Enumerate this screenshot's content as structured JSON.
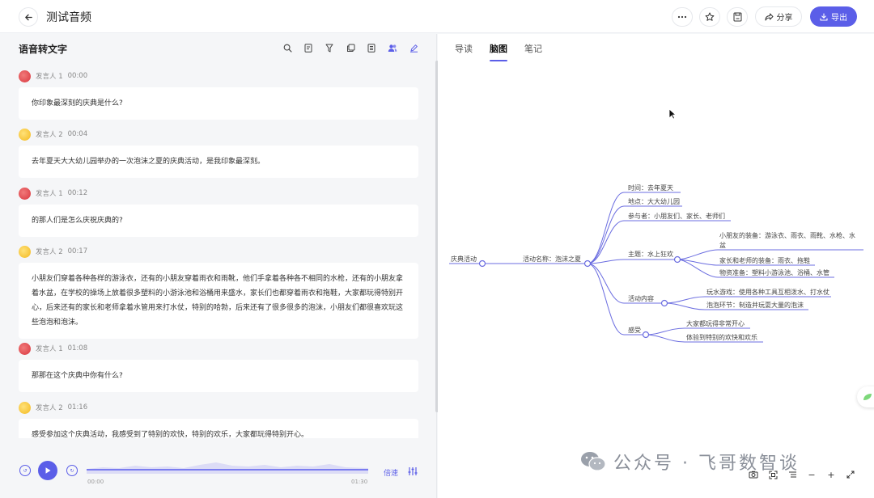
{
  "header": {
    "title": "测试音频",
    "share_label": "分享",
    "export_label": "导出"
  },
  "left_panel": {
    "title": "语音转文字",
    "entries": [
      {
        "speaker": "发言人 1",
        "time": "00:00",
        "avatar": "red",
        "text": "你印象最深刻的庆典是什么?"
      },
      {
        "speaker": "发言人 2",
        "time": "00:04",
        "avatar": "yellow",
        "text": "去年夏天大大幼儿园举办的一次泡沫之夏的庆典活动，是我印象最深刻。"
      },
      {
        "speaker": "发言人 1",
        "time": "00:12",
        "avatar": "red",
        "text": "的那人们是怎么庆祝庆典的?"
      },
      {
        "speaker": "发言人 2",
        "time": "00:17",
        "avatar": "yellow",
        "text": "小朋友们穿着各种各样的游泳衣，还有的小朋友穿着雨衣和雨靴，他们手拿着各种各不相同的水枪，还有的小朋友拿着水盆，在学校的操场上放着很多塑料的小游泳池和浴桶用来盛水，家长们也都穿着雨衣和拖鞋，大家都玩得特别开心，后来还有的家长和老师拿着水管用来打水仗，特别的哈勃，后来还有了很多很多的泡沫，小朋友们都很喜欢玩这些泡泡和泡沫。"
      },
      {
        "speaker": "发言人 1",
        "time": "01:08",
        "avatar": "red",
        "text": "那那在这个庆典中你有什么?"
      },
      {
        "speaker": "发言人 2",
        "time": "01:16",
        "avatar": "yellow",
        "text": "感受参加这个庆典活动，我感受到了特别的欢快，特别的欢乐，大家都玩得特别开心。"
      }
    ]
  },
  "player": {
    "current_time": "00:00",
    "total_time": "01:30",
    "speed_label": "倍速",
    "progress": 0
  },
  "right_panel": {
    "tabs": [
      {
        "label": "导读",
        "active": false
      },
      {
        "label": "脑图",
        "active": true
      },
      {
        "label": "笔记",
        "active": false
      }
    ],
    "mindmap": {
      "root": "庆典活动",
      "level1": "活动名称：泡沫之夏",
      "time": "时间：去年夏天",
      "place": "地点：大大幼儿园",
      "participants": "参与者：小朋友们、家长、老师们",
      "theme": "主题：水上狂欢",
      "kids_gear_1": "小朋友的装备：游泳衣、雨衣、雨靴、水枪、水",
      "kids_gear_2": "盆",
      "parents_gear": "家长和老师的装备：雨衣、拖鞋",
      "supplies": "物资准备：塑料小游泳池、浴桶、水管",
      "content": "活动内容",
      "water_game": "玩水游戏：使用各种工具互相泼水、打水仗",
      "bubble": "泡泡环节：制造并玩耍大量的泡沫",
      "feeling": "感受",
      "feeling_1": "大家都玩得非常开心",
      "feeling_2": "体验到特别的欢快和欢乐"
    }
  },
  "watermark": {
    "text": "公众号 · 飞哥数智谈"
  },
  "colors": {
    "accent": "#5b5ee8"
  }
}
